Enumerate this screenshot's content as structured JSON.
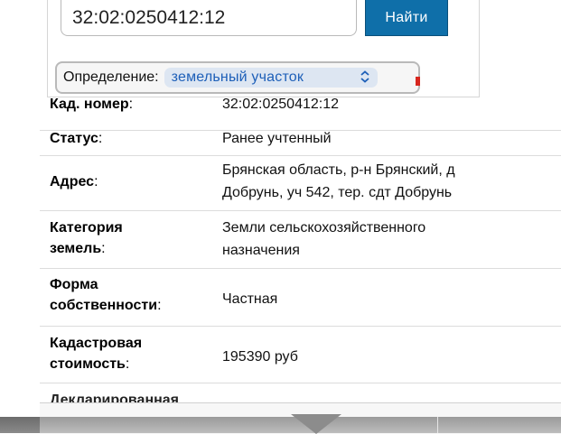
{
  "search": {
    "value": "32:02:0250412:12",
    "button_label": "Найти"
  },
  "definition": {
    "label": "Определение:",
    "selected": "земельный участок",
    "icon": "chevron-updown-icon"
  },
  "details": [
    {
      "key": "Кад. номер",
      "suffix": ":",
      "value": "32:02:0250412:12"
    },
    {
      "key": "Статус",
      "suffix": ":",
      "value": "Ранее учтенный"
    },
    {
      "key": "Адрес",
      "suffix": ":",
      "value_lines": [
        "Брянская область, р-н Брянский, д",
        "Добрунь, уч 542, тер. сдт Добрунь"
      ]
    },
    {
      "key_lines": [
        "Категория",
        "земель"
      ],
      "suffix": ":",
      "value_lines": [
        "Земли сельскохозяйственного",
        "назначения"
      ]
    },
    {
      "key_lines": [
        "Форма",
        "собственности"
      ],
      "suffix": ":",
      "value": "Частная"
    },
    {
      "key_lines": [
        "Кадастровая",
        "стоимость"
      ],
      "suffix": ":",
      "value": "195390 руб"
    },
    {
      "key": "Декларированная"
    }
  ],
  "colors": {
    "button": "#0f6fa9",
    "select_text": "#1d5fb8",
    "marker": "#d7261e"
  }
}
